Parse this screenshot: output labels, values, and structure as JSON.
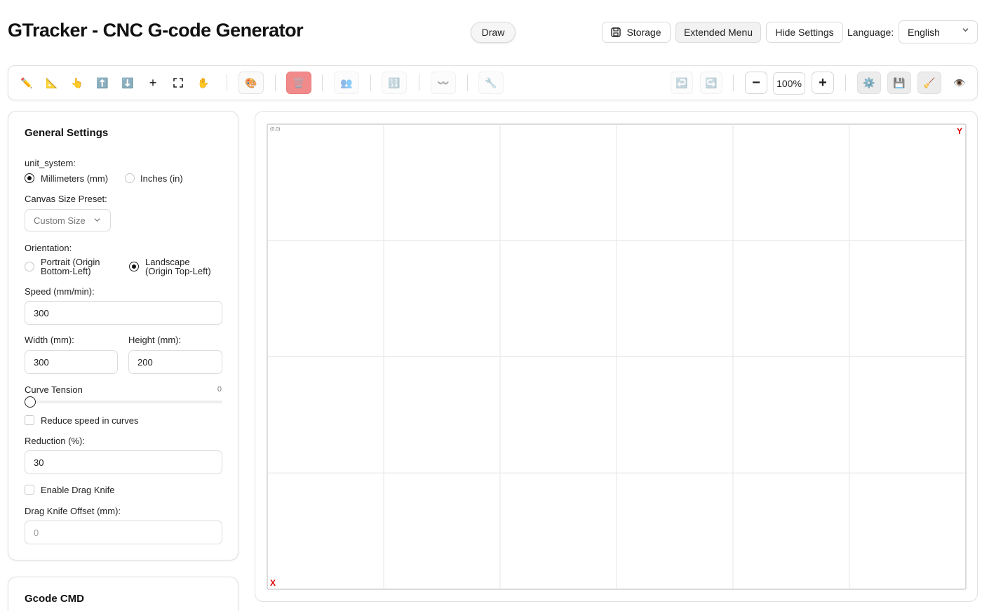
{
  "header": {
    "title": "GTracker - CNC G-code Generator",
    "draw_label": "Draw",
    "storage_label": "Storage",
    "extended_menu_label": "Extended Menu",
    "hide_settings_label": "Hide Settings",
    "language_label": "Language:",
    "language_value": "English"
  },
  "toolbar": {
    "tools": [
      "pencil-icon",
      "ruler-icon",
      "pointer-hand-icon",
      "arrow-up-box-icon",
      "arrow-down-box-icon",
      "plus-icon",
      "fullscreen-icon",
      "hand-pan-icon"
    ],
    "zoom_out": "−",
    "zoom_value": "100%",
    "zoom_in": "+",
    "accent_delete": "#f18a8a"
  },
  "settings": {
    "title": "General Settings",
    "unit_system_label": "unit_system:",
    "unit_mm": "Millimeters (mm)",
    "unit_in": "Inches (in)",
    "unit_selected": "mm",
    "canvas_preset_label": "Canvas Size Preset:",
    "canvas_preset_value": "Custom Size",
    "orientation_label": "Orientation:",
    "portrait_line1": "Portrait (Origin",
    "portrait_line2": "Bottom-Left)",
    "landscape_line1": "Landscape",
    "landscape_line2": "(Origin Top-Left)",
    "orientation_selected": "landscape",
    "speed_label": "Speed (mm/min):",
    "speed_value": "300",
    "width_label": "Width (mm):",
    "width_value": "300",
    "height_label": "Height (mm):",
    "height_value": "200",
    "curve_tension_label": "Curve Tension",
    "curve_tension_value": "0",
    "reduce_speed_label": "Reduce speed in curves",
    "reduction_label": "Reduction (%):",
    "reduction_value": "30",
    "drag_knife_label": "Enable Drag Knife",
    "drag_knife_offset_label": "Drag Knife Offset (mm):",
    "drag_knife_offset_value": "0"
  },
  "gcode_panel": {
    "title": "Gcode CMD"
  },
  "canvas": {
    "origin_label": "(0,0)",
    "y_axis_label": "Y",
    "x_axis_label": "X",
    "axis_color": "#e00000",
    "grid_cols": 6,
    "grid_rows": 4
  }
}
